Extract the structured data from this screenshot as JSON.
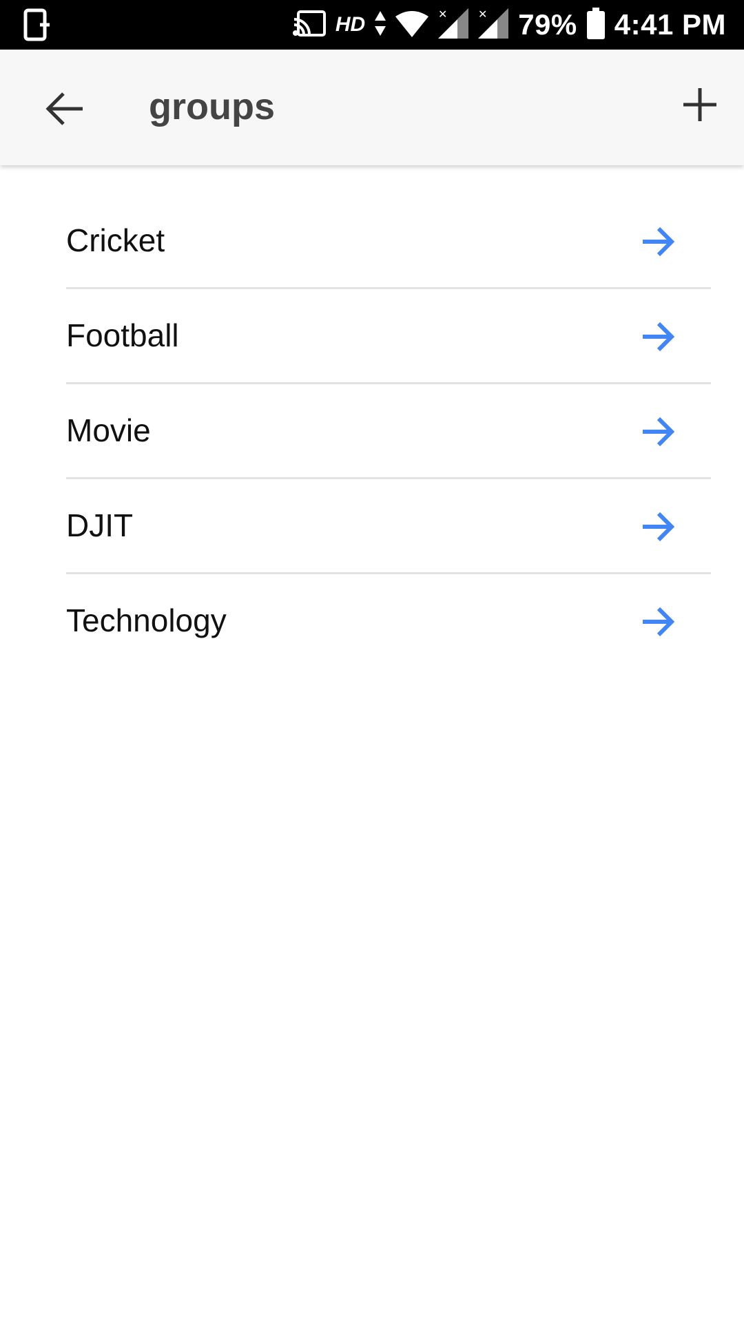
{
  "status_bar": {
    "hd_label": "HD",
    "battery": "79%",
    "time": "4:41 PM"
  },
  "app_bar": {
    "title": "groups",
    "back_icon": "arrow-left-icon",
    "add_icon": "plus-icon"
  },
  "groups": [
    {
      "label": "Cricket"
    },
    {
      "label": "Football"
    },
    {
      "label": "Movie"
    },
    {
      "label": "DJIT"
    },
    {
      "label": "Technology"
    }
  ],
  "colors": {
    "accent_arrow": "#4285f4",
    "app_bar_bg": "#f7f7f7",
    "divider": "#e2e2e2"
  }
}
